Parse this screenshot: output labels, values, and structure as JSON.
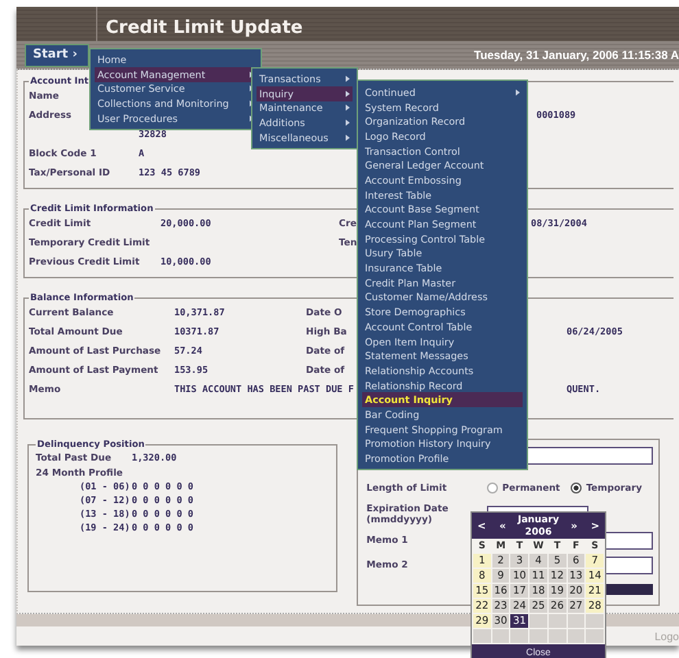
{
  "header": {
    "title": "Credit Limit Update",
    "start_button": "Start ›",
    "date_time": "Tuesday, 31 January, 2006 11:15:38 A"
  },
  "account_info": {
    "legend": "Account Int",
    "rows": [
      {
        "label": "Name"
      },
      {
        "label": "Address",
        "right_value": "0001089"
      },
      {
        "value": "32828"
      },
      {
        "label": "Block Code 1",
        "value": "A"
      },
      {
        "label": "Tax/Personal ID",
        "value": "123 45 6789"
      }
    ]
  },
  "credit_limit_info": {
    "legend": "Credit Limit Information",
    "rows": [
      {
        "label": "Credit Limit",
        "value": "20,000.00",
        "right_label": "Cre",
        "right_value": "08/31/2004"
      },
      {
        "label": "Temporary Credit Limit",
        "right_label": "Ten"
      },
      {
        "label": "Previous Credit Limit",
        "value": "10,000.00"
      }
    ]
  },
  "balance_info": {
    "legend": "Balance Information",
    "rows": [
      {
        "label": "Current Balance",
        "value": "10,371.87",
        "right_label": "Date O"
      },
      {
        "label": "Total Amount Due",
        "value": "10371.87",
        "right_label": "High Ba",
        "right_value": "06/24/2005"
      },
      {
        "label": "Amount of Last Purchase",
        "value": "57.24",
        "right_label": "Date of"
      },
      {
        "label": "Amount of Last Payment",
        "value": "153.95",
        "right_label": "Date of"
      },
      {
        "label": "Memo",
        "value": "THIS ACCOUNT HAS BEEN PAST DUE F",
        "right_value": "QUENT."
      }
    ]
  },
  "delinquency": {
    "legend": "Delinquency Position",
    "total_label": "Total Past Due",
    "total_value": "1,320.00",
    "profile_label": "24 Month Profile",
    "profile_rows": [
      {
        "range": "(01 - 06)",
        "values": "0 0 0 0 0 0"
      },
      {
        "range": "(07 - 12)",
        "values": "0 0 0 0 0 0"
      },
      {
        "range": "(13 - 18)",
        "values": "0 0 0 0 0 0"
      },
      {
        "range": "(19 - 24)",
        "values": "0 0 0 0 0 0"
      }
    ]
  },
  "limit_form": {
    "length_label": "Length of Limit",
    "options": [
      {
        "label": "Permanent",
        "selected": false
      },
      {
        "label": "Temporary",
        "selected": true
      }
    ],
    "expiration_label": "Expiration Date (mmddyyyy)",
    "memo1_label": "Memo 1",
    "memo2_label": "Memo 2"
  },
  "main_menu": [
    {
      "label": "Home",
      "has_submenu": false,
      "selected": false
    },
    {
      "label": "Account Management",
      "has_submenu": true,
      "selected": true
    },
    {
      "label": "Customer Service",
      "has_submenu": true,
      "selected": false
    },
    {
      "label": "Collections and Monitoring",
      "has_submenu": true,
      "selected": false
    },
    {
      "label": "User Procedures",
      "has_submenu": true,
      "selected": false
    }
  ],
  "submenu": [
    {
      "label": "Transactions",
      "has_submenu": true,
      "selected": false
    },
    {
      "label": "Inquiry",
      "has_submenu": true,
      "selected": true
    },
    {
      "label": "Maintenance",
      "has_submenu": true,
      "selected": false
    },
    {
      "label": "Additions",
      "has_submenu": true,
      "selected": false
    },
    {
      "label": "Miscellaneous",
      "has_submenu": true,
      "selected": false
    }
  ],
  "inquiry_menu": [
    {
      "label": "Continued",
      "has_submenu": true,
      "selected": false
    },
    {
      "label": "System Record",
      "has_submenu": false,
      "selected": false
    },
    {
      "label": "Organization Record",
      "has_submenu": false,
      "selected": false
    },
    {
      "label": "Logo Record",
      "has_submenu": false,
      "selected": false
    },
    {
      "label": "Transaction Control",
      "has_submenu": false,
      "selected": false
    },
    {
      "label": "General Ledger Account",
      "has_submenu": false,
      "selected": false
    },
    {
      "label": "Account Embossing",
      "has_submenu": false,
      "selected": false
    },
    {
      "label": "Interest Table",
      "has_submenu": false,
      "selected": false
    },
    {
      "label": "Account Base Segment",
      "has_submenu": false,
      "selected": false
    },
    {
      "label": "Account Plan Segment",
      "has_submenu": false,
      "selected": false
    },
    {
      "label": "Processing Control Table",
      "has_submenu": false,
      "selected": false
    },
    {
      "label": "Usury Table",
      "has_submenu": false,
      "selected": false
    },
    {
      "label": "Insurance Table",
      "has_submenu": false,
      "selected": false
    },
    {
      "label": "Credit Plan Master",
      "has_submenu": false,
      "selected": false
    },
    {
      "label": "Customer Name/Address",
      "has_submenu": false,
      "selected": false
    },
    {
      "label": "Store Demographics",
      "has_submenu": false,
      "selected": false
    },
    {
      "label": "Account Control Table",
      "has_submenu": false,
      "selected": false
    },
    {
      "label": "Open Item Inquiry",
      "has_submenu": false,
      "selected": false
    },
    {
      "label": "Statement Messages",
      "has_submenu": false,
      "selected": false
    },
    {
      "label": "Relationship Accounts",
      "has_submenu": false,
      "selected": false
    },
    {
      "label": "Relationship Record",
      "has_submenu": false,
      "selected": false
    },
    {
      "label": "Account Inquiry",
      "has_submenu": false,
      "selected": true
    },
    {
      "label": "Bar Coding",
      "has_submenu": false,
      "selected": false
    },
    {
      "label": "Frequent Shopping Program",
      "has_submenu": false,
      "selected": false
    },
    {
      "label": "Promotion History Inquiry",
      "has_submenu": false,
      "selected": false
    },
    {
      "label": "Promotion Profile",
      "has_submenu": false,
      "selected": false
    }
  ],
  "calendar": {
    "prev_month": "<",
    "prev_year": "«",
    "month": "January",
    "year": "2006",
    "next_year": "»",
    "next_month": ">",
    "weekdays": [
      "S",
      "M",
      "T",
      "W",
      "T",
      "F",
      "S"
    ],
    "days": [
      {
        "day": "1",
        "selected": false
      },
      {
        "day": "2",
        "selected": false
      },
      {
        "day": "3",
        "selected": false
      },
      {
        "day": "4",
        "selected": false
      },
      {
        "day": "5",
        "selected": false
      },
      {
        "day": "6",
        "selected": false
      },
      {
        "day": "7",
        "selected": false
      },
      {
        "day": "8",
        "selected": false
      },
      {
        "day": "9",
        "selected": false
      },
      {
        "day": "10",
        "selected": false
      },
      {
        "day": "11",
        "selected": false
      },
      {
        "day": "12",
        "selected": false
      },
      {
        "day": "13",
        "selected": false
      },
      {
        "day": "14",
        "selected": false
      },
      {
        "day": "15",
        "selected": false
      },
      {
        "day": "16",
        "selected": false
      },
      {
        "day": "17",
        "selected": false
      },
      {
        "day": "18",
        "selected": false
      },
      {
        "day": "19",
        "selected": false
      },
      {
        "day": "20",
        "selected": false
      },
      {
        "day": "21",
        "selected": false
      },
      {
        "day": "22",
        "selected": false
      },
      {
        "day": "23",
        "selected": false
      },
      {
        "day": "24",
        "selected": false
      },
      {
        "day": "25",
        "selected": false
      },
      {
        "day": "26",
        "selected": false
      },
      {
        "day": "27",
        "selected": false
      },
      {
        "day": "28",
        "selected": false
      },
      {
        "day": "29",
        "selected": false
      },
      {
        "day": "30",
        "selected": false
      },
      {
        "day": "31",
        "selected": true
      }
    ],
    "close_button": "Close"
  },
  "footer": {
    "logout_link": "Logo"
  }
}
